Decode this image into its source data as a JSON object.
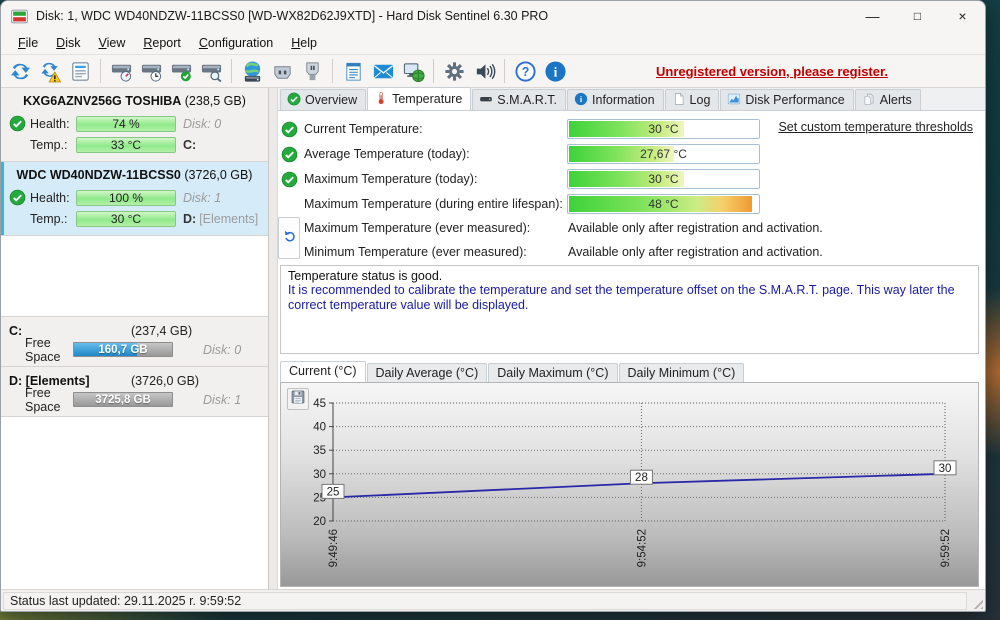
{
  "window": {
    "title": "Disk: 1, WDC WD40NDZW-11BCSS0 [WD-WX82D62J9XTD]  -  Hard Disk Sentinel 6.30 PRO",
    "minimize_glyph": "—",
    "maximize_glyph": "□",
    "close_glyph": "×"
  },
  "menu": {
    "items": [
      "File",
      "Disk",
      "View",
      "Report",
      "Configuration",
      "Help"
    ]
  },
  "toolbar": {
    "icons": [
      "refresh",
      "refresh-warning",
      "report",
      "disk-gauge",
      "disk-clock",
      "disk-check",
      "disk-search",
      "globe-disk",
      "disk-connector",
      "disk-plug",
      "notepad",
      "mail",
      "network-monitor",
      "gear",
      "speaker",
      "help",
      "info"
    ],
    "register_notice": "Unregistered version, please register."
  },
  "sidebar": {
    "disks": [
      {
        "name": "KXG6AZNV256G TOSHIBA",
        "size": "(238,5 GB)",
        "health_label": "Health:",
        "temp_label": "Temp.:",
        "health": "74 %",
        "temp": "33 °C",
        "disk_label": "Disk: 0",
        "drive": "C:",
        "drive_extra": ""
      },
      {
        "name": "WDC WD40NDZW-11BCSS0",
        "size": "(3726,0 GB)",
        "health_label": "Health:",
        "temp_label": "Temp.:",
        "health": "100 %",
        "temp": "30 °C",
        "disk_label": "Disk: 1",
        "drive": "D:",
        "drive_extra": "[Elements]"
      }
    ],
    "partitions": [
      {
        "name": "C:",
        "size": "(237,4 GB)",
        "free_label": "Free Space",
        "free": "160,7 GB",
        "free_pct": 64,
        "disk_label": "Disk: 0"
      },
      {
        "name": "D: [Elements]",
        "size": "(3726,0 GB)",
        "free_label": "Free Space",
        "free": "3725,8 GB",
        "free_pct": 0,
        "disk_label": "Disk: 1"
      }
    ]
  },
  "tabs": [
    {
      "label": "Overview"
    },
    {
      "label": "Temperature"
    },
    {
      "label": "S.M.A.R.T."
    },
    {
      "label": "Information"
    },
    {
      "label": "Log"
    },
    {
      "label": "Disk Performance"
    },
    {
      "label": "Alerts"
    }
  ],
  "temperature": {
    "rows": [
      {
        "label": "Current Temperature:",
        "value": "30 °C",
        "pct": 60,
        "hot": false
      },
      {
        "label": "Average Temperature (today):",
        "value": "27,67 °C",
        "pct": 55,
        "hot": false
      },
      {
        "label": "Maximum Temperature (today):",
        "value": "30 °C",
        "pct": 60,
        "hot": false
      },
      {
        "label": "Maximum Temperature (during entire lifespan):",
        "value": "48 °C",
        "pct": 96,
        "hot": true
      }
    ],
    "locked_rows": [
      {
        "label": "Maximum Temperature (ever measured):",
        "value": "Available only after registration and activation."
      },
      {
        "label": "Minimum Temperature (ever measured):",
        "value": "Available only after registration and activation."
      }
    ],
    "thresholds_link": "Set custom temperature thresholds",
    "status_line1": "Temperature status is good.",
    "status_line2": "It is recommended to calibrate the temperature and set the temperature offset on the S.M.A.R.T. page. This way later the correct temperature value will be displayed."
  },
  "chart_tabs": [
    "Current (°C)",
    "Daily Average (°C)",
    "Daily Maximum (°C)",
    "Daily Minimum (°C)"
  ],
  "chart_data": {
    "type": "line",
    "title": "Current (°C)",
    "x_labels": [
      "9:49:46",
      "9:54:52",
      "9:59:52"
    ],
    "x_fractions": [
      0,
      0.504,
      1
    ],
    "series": [
      {
        "name": "Current temperature",
        "values": [
          25,
          28,
          30
        ]
      }
    ],
    "annotations": [
      "25",
      "28",
      "30"
    ],
    "yticks": [
      20,
      25,
      30,
      35,
      40,
      45
    ],
    "ylim": [
      20,
      45
    ],
    "line_color": "#2828a8",
    "grid": "dotted"
  },
  "statusbar": {
    "text": "Status last updated: 29.11.2025 r. 9:59:52"
  }
}
